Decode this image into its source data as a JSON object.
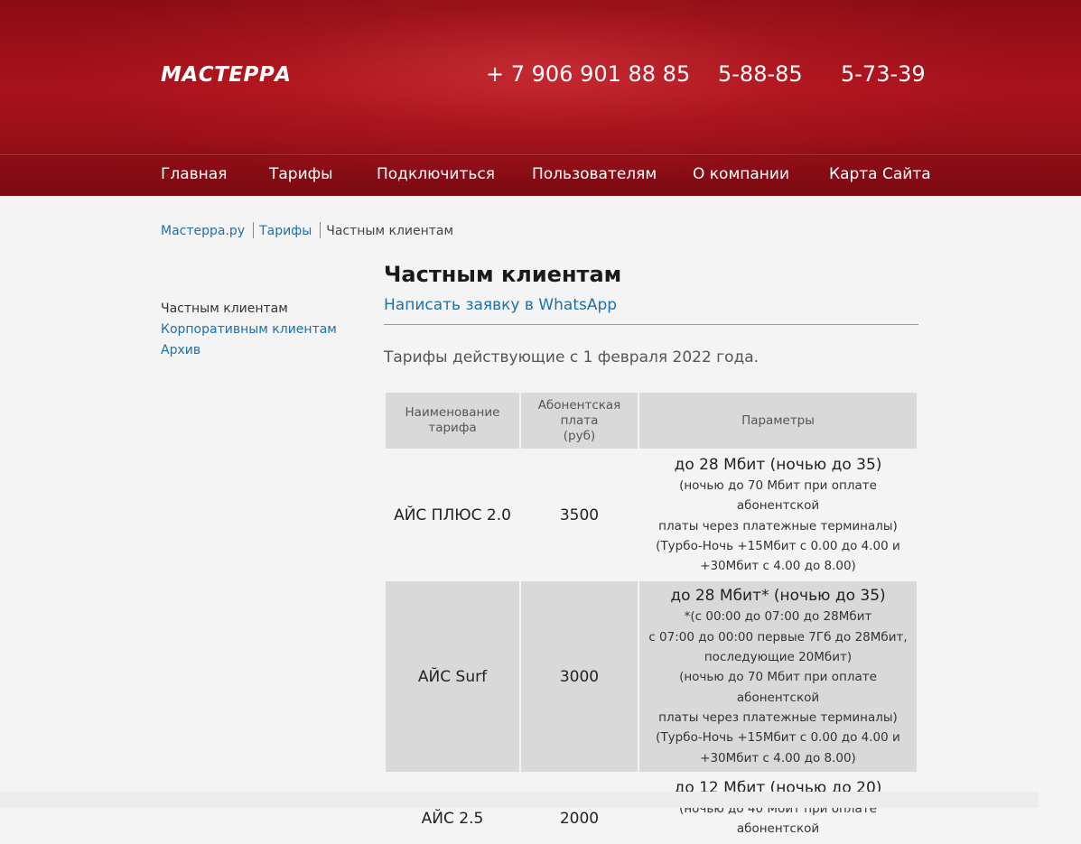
{
  "header": {
    "logo": "МАСТЕРРА",
    "phones": [
      "+ 7 906 901 88 85",
      "5-88-85",
      "5-73-39"
    ]
  },
  "nav": {
    "items": [
      "Главная",
      "Тарифы",
      "Подключиться",
      "Пользователям",
      "О компании",
      "Карта Сайта"
    ]
  },
  "breadcrumb": {
    "home": "Мастерра.ру",
    "section": "Тарифы",
    "current": "Частным клиентам"
  },
  "sidebar": {
    "items": [
      {
        "label": "Частным клиентам"
      },
      {
        "label": "Корпоративным клиентам"
      },
      {
        "label": "Архив"
      }
    ]
  },
  "main": {
    "title": "Частным клиентам",
    "whatsapp_link": "Написать заявку в WhatsApp",
    "intro": "Тарифы действующие с 1 февраля 2022 года."
  },
  "table": {
    "headers": {
      "name": [
        "Наименование",
        "тарифа"
      ],
      "fee": [
        "Абонентская",
        "плата",
        "(руб)"
      ],
      "params": "Параметры"
    },
    "rows": [
      {
        "name": "АЙС ПЛЮС 2.0",
        "fee": "3500",
        "main": "до 28 Мбит (ночью до 35)",
        "lines": [
          "(ночью до 70 Мбит при оплате абонентской",
          "платы через платежные терминалы)",
          "(Турбо-Ночь +15Мбит с 0.00 до 4.00 и",
          "+30Мбит с 4.00 до 8.00)"
        ]
      },
      {
        "name": "АЙС Surf",
        "fee": "3000",
        "main": "до 28 Мбит* (ночью до 35)",
        "lines": [
          "*(с 00:00 до 07:00 до 28Мбит",
          "с 07:00 до 00:00 первые 7Гб до 28Мбит,",
          "последующие 20Мбит)",
          "(ночью до 70 Мбит при оплате абонентской",
          "платы через платежные терминалы)",
          "(Турбо-Ночь +15Мбит с 0.00 до 4.00 и",
          "+30Мбит с 4.00 до 8.00)"
        ]
      },
      {
        "name": "АЙС 2.5",
        "fee": "2000",
        "main": "до 12 Мбит (ночью до 20)",
        "lines": [
          "(ночью до 40 Мбит при оплате абонентской"
        ]
      }
    ]
  }
}
